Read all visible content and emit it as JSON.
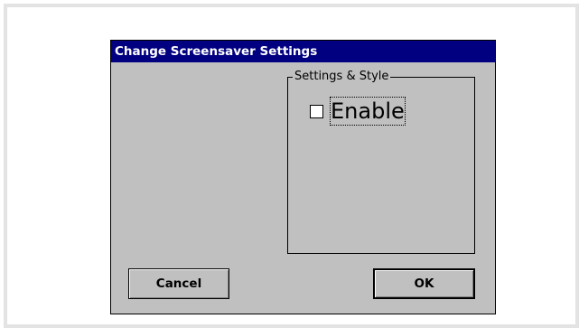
{
  "dialog": {
    "title": "Change Screensaver Settings"
  },
  "group": {
    "legend": "Settings & Style",
    "enable": {
      "label": "Enable",
      "checked": false
    }
  },
  "buttons": {
    "cancel_label": "Cancel",
    "ok_label": "OK"
  },
  "colors": {
    "titlebar": "#000080",
    "dialog_bg": "#c0c0c0",
    "frame": "#e3e3e3"
  }
}
